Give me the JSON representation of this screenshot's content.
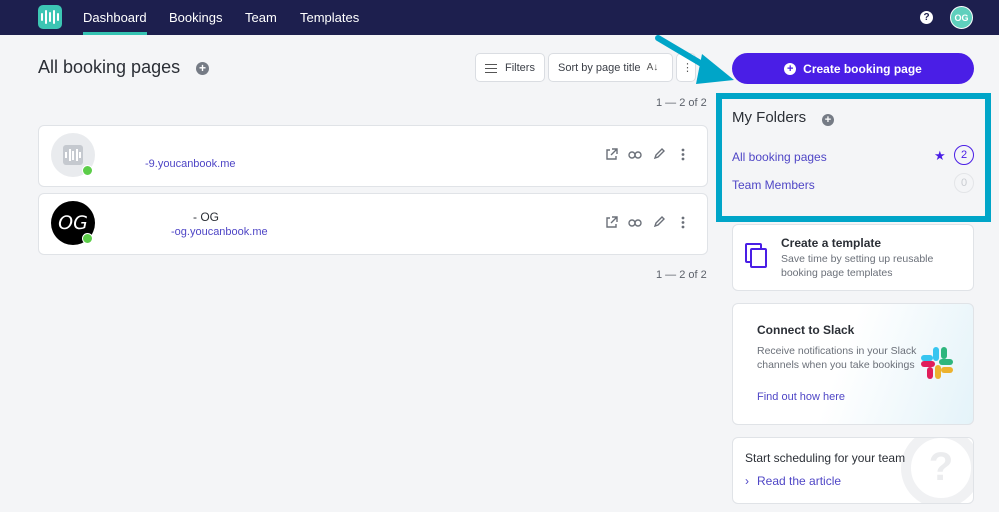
{
  "nav": {
    "items": [
      "Dashboard",
      "Bookings",
      "Team",
      "Templates"
    ],
    "help_label": "?",
    "avatar_initials": "OG"
  },
  "header": {
    "title": "All booking pages",
    "add_symbol": "+",
    "filters_label": "Filters",
    "sort_label": "Sort by page title",
    "more_symbol": "⋮",
    "pagination": "1 — 2 of 2"
  },
  "booking_pages": [
    {
      "name": "",
      "link": "-9.youcanbook.me",
      "avatar_text": "",
      "status": "online"
    },
    {
      "name": "- OG",
      "link": "-og.youcanbook.me",
      "avatar_text": "OG",
      "status": "online"
    }
  ],
  "pagination_bottom": "1 — 2 of 2",
  "create_button": {
    "label": "Create booking page",
    "icon": "plus-circle-icon"
  },
  "folders": {
    "title": "My Folders",
    "items": [
      {
        "label": "All booking pages",
        "count": "2",
        "starred": true
      },
      {
        "label": "Team Members",
        "count": "0",
        "starred": false
      }
    ]
  },
  "template_card": {
    "title": "Create a template",
    "description": "Save time by setting up reusable booking page templates"
  },
  "slack_card": {
    "title": "Connect to Slack",
    "description": "Receive notifications in your Slack channels when you take bookings",
    "link": "Find out how here"
  },
  "team_card": {
    "title": "Start scheduling for your team",
    "link": "Read the article",
    "deco_symbol": "?"
  },
  "colors": {
    "nav_bg": "#1d1f4e",
    "accent": "#4a1ee6",
    "highlight_box": "#00a5c8",
    "status_online": "#5ccd49",
    "link": "#4f46c6"
  }
}
